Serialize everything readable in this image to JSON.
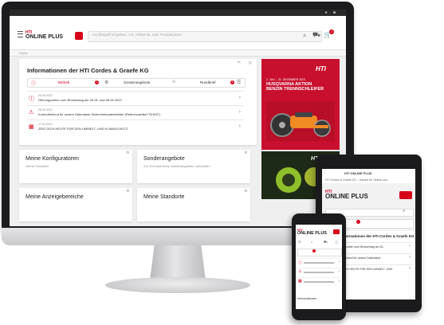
{
  "desktop": {
    "search": {
      "placeholder": "Suchbegriff eingeben, z.B. Artikel-Nr. oder Produktname"
    },
    "cart": {
      "count": "1"
    },
    "logo": {
      "hti": "HTI",
      "online_plus": "ONLINE PLUS"
    },
    "breadcrumb": "Home",
    "info_card": {
      "title": "Informationen der HTI Cordes & Graefe KG",
      "tabs": [
        {
          "label": "Betrieb",
          "badge": "2",
          "icon": "info-icon"
        },
        {
          "label": "Sonderangebote",
          "badge": "",
          "icon": "tag-icon"
        },
        {
          "label": "Rundbrief",
          "badge": "3",
          "icon": "chat-icon"
        }
      ],
      "news": [
        {
          "date": "06.05.2022",
          "text": "Öffnungszeiten zum Brückentag am 26.05. und 08.06.2022",
          "icon": "info-icon"
        },
        {
          "date": "28.02.2022",
          "text": "Kontrollbefund für unsere Datenbank Sicherheitsdatenblätter (Referenzartikel \"DHKD\")",
          "icon": "alert-icon"
        },
        {
          "date": "17.04.2022",
          "text": "ZEIG DICH HEUTE FÜR DEN UMWELT- UND KLIMASCHUTZ",
          "icon": "calendar-icon"
        }
      ]
    },
    "promo": {
      "logo": "HTI",
      "date": "1. JULI – 31. DEZEMBER 2023",
      "title_line1": "HUSQVARNA AKTION",
      "title_line2": "BENZIN TRENNSCHLEIFER"
    },
    "promo2": {
      "logo": "HTI"
    },
    "tiles": [
      {
        "title": "Meine Konfiguratoren",
        "subtitle": "Gerne Favoriten"
      },
      {
        "title": "Sonderangebote",
        "subtitle": "Zur Zeit sind keine Sonderangebote vorhanden"
      },
      {
        "title": "Meine Anzeigebereiche",
        "subtitle": ""
      },
      {
        "title": "Meine Standorte",
        "subtitle": ""
      }
    ],
    "colors": {
      "brand_red": "#d7001a",
      "promo_red": "#c8102e",
      "screen_bg": "#efefef"
    }
  },
  "tablet": {
    "header_title": "HTI ONLINE PLUS",
    "subheader": "HTI Cordes & Graefe KG – Handel für Tiefbau und",
    "logo": {
      "hti": "HTI",
      "online_plus": "ONLINE PLUS"
    },
    "card_title": "Informationen der HTI Cordes & Graefe KG",
    "rows": [
      "Öffnungszeiten zum Brückentag am 26.",
      "Kontrollbefund für unsere Datenbank",
      "ZEIG DICH HEUTE FÜR DEN UMWELT- UND"
    ]
  },
  "phone": {
    "logo": {
      "hti": "HTI",
      "online_plus": "ONLINE PLUS"
    },
    "bottom_title": "Informationen"
  }
}
